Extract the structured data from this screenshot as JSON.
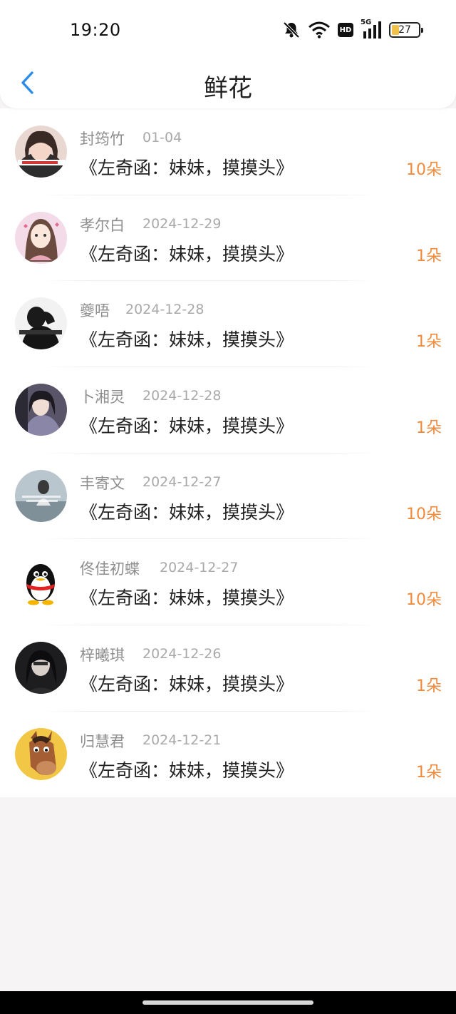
{
  "status_bar": {
    "time": "19:20",
    "icons": [
      "bell-muted-icon",
      "wifi-icon",
      "hd-icon",
      "signal-5g-icon",
      "battery-icon"
    ],
    "hd_label": "HD",
    "network_label": "5G",
    "battery_level": "27"
  },
  "header": {
    "title": "鲜花",
    "back_icon": "chevron-left-icon",
    "accent_color": "#2b8de6"
  },
  "colors": {
    "count_color": "#f08a3c",
    "name_color": "#8e8e8e",
    "date_color": "#a9a9a9"
  },
  "gifts": [
    {
      "name": "封筠竹",
      "date": "01-04",
      "song": "《左奇函：妹妹，摸摸头》",
      "count": "10朵",
      "avatar": "avatar-photo-icon"
    },
    {
      "name": "孝尔白",
      "date": "2024-12-29",
      "song": "《左奇函：妹妹，摸摸头》",
      "count": "1朵",
      "avatar": "avatar-illustration-icon"
    },
    {
      "name": "夔唔",
      "date": "2024-12-28",
      "song": "《左奇函：妹妹，摸摸头》",
      "count": "1朵",
      "avatar": "avatar-photo-icon"
    },
    {
      "name": "卜湘灵",
      "date": "2024-12-28",
      "song": "《左奇函：妹妹，摸摸头》",
      "count": "1朵",
      "avatar": "avatar-photo-icon"
    },
    {
      "name": "丰寄文",
      "date": "2024-12-27",
      "song": "《左奇函：妹妹，摸摸头》",
      "count": "10朵",
      "avatar": "avatar-photo-icon"
    },
    {
      "name": "佟佳初蝶",
      "date": "2024-12-27",
      "song": "《左奇函：妹妹，摸摸头》",
      "count": "10朵",
      "avatar": "qq-penguin-icon"
    },
    {
      "name": "梓曦琪",
      "date": "2024-12-26",
      "song": "《左奇函：妹妹，摸摸头》",
      "count": "1朵",
      "avatar": "avatar-photo-icon"
    },
    {
      "name": "归慧君",
      "date": "2024-12-21",
      "song": "《左奇函：妹妹，摸摸头》",
      "count": "1朵",
      "avatar": "horse-cartoon-icon"
    }
  ]
}
